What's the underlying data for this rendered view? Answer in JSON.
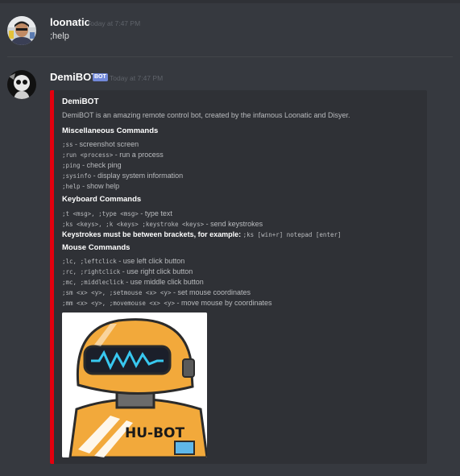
{
  "colors": {
    "background": "#36393f",
    "embed_background": "#2f3136",
    "embed_accent": "#e3000e",
    "bot_tag": "#7289da",
    "username": "#ffffff",
    "muted": "#5f636a"
  },
  "message1": {
    "author": "loonatic",
    "timestamp": "Today at 7:47 PM",
    "text": ";help",
    "avatar_icon": "user-avatar-photo-icon"
  },
  "message2": {
    "author": "DemiBOT",
    "bot_tag": "BOT",
    "timestamp": "Today at 7:47 PM",
    "avatar_icon": "bot-avatar-icon",
    "embed": {
      "title": "DemiBOT",
      "description": "DemiBOT is an amazing remote control bot, created by the infamous Loonatic and Disyer.",
      "sections": [
        {
          "heading": "Miscellaneous Commands",
          "lines": [
            {
              "code": ";ss",
              "text": " - screenshot screen"
            },
            {
              "code": ";run <process>",
              "text": " - run a process"
            },
            {
              "code": ";ping",
              "text": " - check ping"
            },
            {
              "code": ";sysinfo",
              "text": " - display system information"
            },
            {
              "code": ";help",
              "text": " - show help"
            }
          ]
        },
        {
          "heading": "Keyboard Commands",
          "lines": [
            {
              "code": ";t <msg>, ;type <msg>",
              "text": " - type text"
            },
            {
              "code": ";ks <keys>, ;k <keys> ;keystroke <keys>",
              "text": " - send keystrokes"
            }
          ],
          "note_bold": "Keystrokes must be between brackets, for example: ",
          "note_code": ";ks [win+r] notepad [enter]"
        },
        {
          "heading": "Mouse Commands",
          "lines": [
            {
              "code": ";lc, ;leftclick",
              "text": " - use left click button"
            },
            {
              "code": ";rc, ;rightclick",
              "text": " - use right click button"
            },
            {
              "code": ";mc, ;middleclick",
              "text": " - use middle click button"
            },
            {
              "code": ";sm <x> <y>, ;setmouse <x> <y>",
              "text": " - set mouse coordinates"
            },
            {
              "code": ";mm <x> <y>, ;movemouse <x> <y>",
              "text": " - move mouse by coordinates"
            }
          ]
        }
      ],
      "image": {
        "label": "HU-BOT",
        "icon": "robot-illustration-icon"
      }
    }
  }
}
